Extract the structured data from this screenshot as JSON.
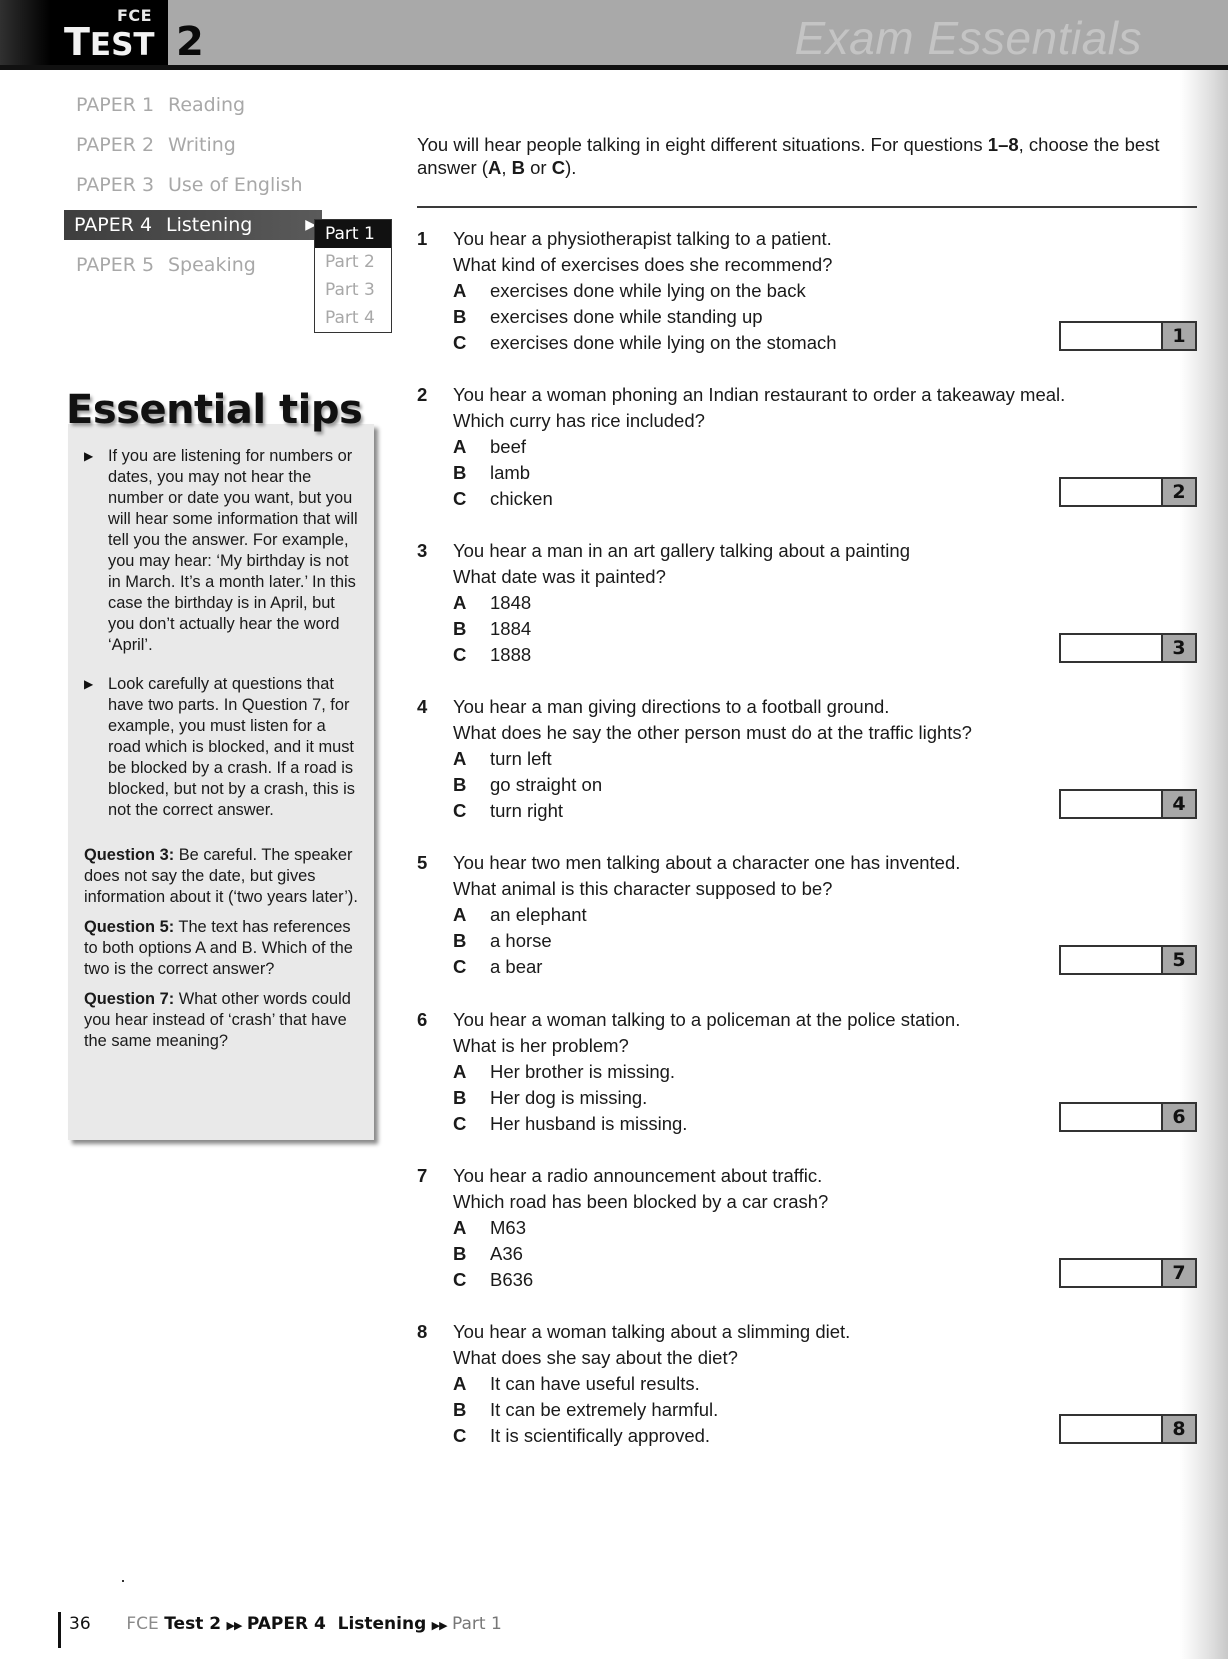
{
  "header": {
    "exam_label": "FCE",
    "test_word": "Test",
    "test_number": "2",
    "brand": "Exam Essentials"
  },
  "paper_nav": {
    "items": [
      {
        "paper": "PAPER 1",
        "name": "Reading",
        "active": false
      },
      {
        "paper": "PAPER 2",
        "name": "Writing",
        "active": false
      },
      {
        "paper": "PAPER 3",
        "name": "Use of English",
        "active": false
      },
      {
        "paper": "PAPER 4",
        "name": "Listening",
        "active": true
      },
      {
        "paper": "PAPER 5",
        "name": "Speaking",
        "active": false
      }
    ],
    "arrow_icon": "▶",
    "parts": [
      {
        "label": "Part 1",
        "active": true
      },
      {
        "label": "Part 2",
        "active": false
      },
      {
        "label": "Part 3",
        "active": false
      },
      {
        "label": "Part 4",
        "active": false
      }
    ]
  },
  "tips": {
    "title": "Essential tips",
    "bullet_icon": "▶",
    "bullets": [
      "If you are listening for numbers or dates, you may not hear the number or date you want, but you will hear some information that will tell you the answer. For example, you may hear: ‘My birthday is not in March. It’s a month later.’ In this case the birthday is in April, but you don’t actually hear the word ‘April’.",
      "Look carefully at questions that have two parts. In Question 7, for example, you must listen for a road which is blocked, and it must be blocked by a crash. If a road is blocked, but not by a crash, this is not the correct answer."
    ],
    "notes": [
      {
        "label": "Question 3:",
        "text": " Be careful. The speaker does not say the date, but gives information about it (‘two years later’)."
      },
      {
        "label": "Question 5:",
        "text": " The text has references to both options A and B. Which of the two is the correct answer?"
      },
      {
        "label": "Question 7:",
        "text": " What other words could you hear instead of ‘crash’ that have the same meaning?"
      }
    ]
  },
  "instructions": {
    "text_1": "You will hear people talking in eight different situations. For questions ",
    "range": "1–8",
    "text_2": ", choose the best answer (",
    "a": "A",
    "sep1": ", ",
    "b": "B",
    "or": " or ",
    "c": "C",
    "text_3": ")."
  },
  "questions": [
    {
      "number": "1",
      "context": "You hear a physiotherapist talking to a patient.",
      "question": "What kind of exercises does she recommend?",
      "options": [
        {
          "letter": "A",
          "text": "exercises done while lying on the back"
        },
        {
          "letter": "B",
          "text": "exercises done while standing up"
        },
        {
          "letter": "C",
          "text": "exercises done while lying on the stomach"
        }
      ],
      "answer": ""
    },
    {
      "number": "2",
      "context": "You hear a woman phoning an Indian restaurant to order a takeaway meal.",
      "question": "Which curry has rice included?",
      "options": [
        {
          "letter": "A",
          "text": "beef"
        },
        {
          "letter": "B",
          "text": "lamb"
        },
        {
          "letter": "C",
          "text": "chicken"
        }
      ],
      "answer": ""
    },
    {
      "number": "3",
      "context": "You hear a man in an art gallery talking about a painting",
      "question": "What date was it painted?",
      "options": [
        {
          "letter": "A",
          "text": "1848"
        },
        {
          "letter": "B",
          "text": "1884"
        },
        {
          "letter": "C",
          "text": "1888"
        }
      ],
      "answer": ""
    },
    {
      "number": "4",
      "context": "You hear a man giving directions to a football ground.",
      "question": "What does he say the other person must do at the traffic lights?",
      "options": [
        {
          "letter": "A",
          "text": "turn left"
        },
        {
          "letter": "B",
          "text": "go straight on"
        },
        {
          "letter": "C",
          "text": "turn right"
        }
      ],
      "answer": ""
    },
    {
      "number": "5",
      "context": "You hear two men talking about a character one has invented.",
      "question": "What animal is this character supposed to be?",
      "options": [
        {
          "letter": "A",
          "text": "an elephant"
        },
        {
          "letter": "B",
          "text": "a horse"
        },
        {
          "letter": "C",
          "text": "a bear"
        }
      ],
      "answer": ""
    },
    {
      "number": "6",
      "context": "You hear a woman talking to a policeman at the police station.",
      "question": "What is her problem?",
      "options": [
        {
          "letter": "A",
          "text": "Her brother is missing."
        },
        {
          "letter": "B",
          "text": "Her dog is missing."
        },
        {
          "letter": "C",
          "text": "Her husband is missing."
        }
      ],
      "answer": ""
    },
    {
      "number": "7",
      "context": "You hear a radio announcement about traffic.",
      "question": "Which road has been blocked by a car crash?",
      "options": [
        {
          "letter": "A",
          "text": "M63"
        },
        {
          "letter": "B",
          "text": "A36"
        },
        {
          "letter": "C",
          "text": "B636"
        }
      ],
      "answer": ""
    },
    {
      "number": "8",
      "context": "You hear a woman talking about a slimming diet.",
      "question": "What does she say about the diet?",
      "options": [
        {
          "letter": "A",
          "text": "It can have useful results."
        },
        {
          "letter": "B",
          "text": "It can be extremely harmful."
        },
        {
          "letter": "C",
          "text": "It is scientifically approved."
        }
      ],
      "answer": ""
    }
  ],
  "footer": {
    "page_number": "36",
    "exam": "FCE",
    "test": "Test 2",
    "arrow_icon": "▶▶",
    "paper": "PAPER 4  Listening",
    "part": "Part 1"
  },
  "colors": {
    "banner": "#a9a9a9",
    "active_nav": "#4a4a4a",
    "tips_box": "#e9e9e9",
    "answer_num_bg": "#a8a8a8"
  }
}
